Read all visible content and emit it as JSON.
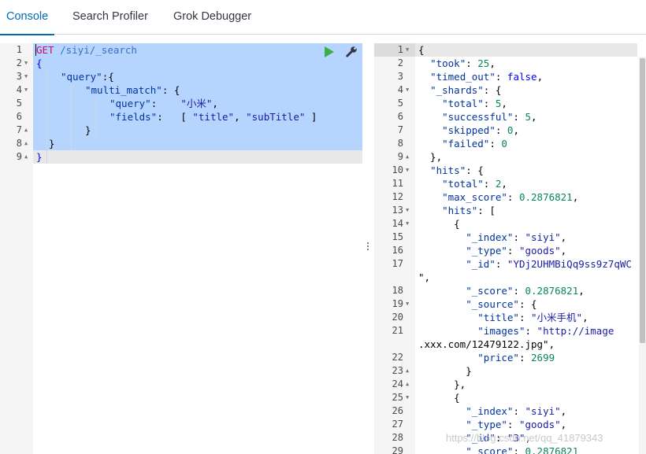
{
  "tabs": [
    {
      "label": "Console",
      "active": true
    },
    {
      "label": "Search Profiler",
      "active": false
    },
    {
      "label": "Grok Debugger",
      "active": false
    }
  ],
  "request": {
    "method": "GET",
    "path": "/siyi/_search",
    "lines": [
      {
        "num": "1",
        "fold": ""
      },
      {
        "num": "2",
        "fold": "▼"
      },
      {
        "num": "3",
        "fold": "▼"
      },
      {
        "num": "4",
        "fold": "▼"
      },
      {
        "num": "5",
        "fold": ""
      },
      {
        "num": "6",
        "fold": ""
      },
      {
        "num": "7",
        "fold": "▲"
      },
      {
        "num": "8",
        "fold": "▲"
      },
      {
        "num": "9",
        "fold": "▲"
      }
    ],
    "tokens": {
      "open_brace": "{",
      "query_key": "\"query\"",
      "query_sep": ":{",
      "multi_match_key": "\"multi_match\"",
      "multi_match_sep": ": {",
      "inner_query_key": "\"query\"",
      "inner_query_sep": ":    ",
      "inner_query_val": "\"小米\"",
      "inner_query_end": ",",
      "fields_key": "\"fields\"",
      "fields_sep": ":   [ ",
      "field1": "\"title\"",
      "field_comma": ", ",
      "field2": "\"subTitle\"",
      "fields_end": " ]",
      "close_inner": "}",
      "close_query": "}",
      "close_root": "}"
    }
  },
  "toolbar": {
    "run_icon": "play-icon",
    "settings_icon": "wrench-icon",
    "run_color": "#3caf48"
  },
  "response": {
    "lines": [
      {
        "num": "1",
        "fold": "▼"
      },
      {
        "num": "2",
        "fold": ""
      },
      {
        "num": "3",
        "fold": ""
      },
      {
        "num": "4",
        "fold": "▼"
      },
      {
        "num": "5",
        "fold": ""
      },
      {
        "num": "6",
        "fold": ""
      },
      {
        "num": "7",
        "fold": ""
      },
      {
        "num": "8",
        "fold": ""
      },
      {
        "num": "9",
        "fold": "▲"
      },
      {
        "num": "10",
        "fold": "▼"
      },
      {
        "num": "11",
        "fold": ""
      },
      {
        "num": "12",
        "fold": ""
      },
      {
        "num": "13",
        "fold": "▼"
      },
      {
        "num": "14",
        "fold": "▼"
      },
      {
        "num": "15",
        "fold": ""
      },
      {
        "num": "16",
        "fold": ""
      },
      {
        "num": "17",
        "fold": ""
      },
      {
        "num": "",
        "fold": ""
      },
      {
        "num": "18",
        "fold": ""
      },
      {
        "num": "19",
        "fold": "▼"
      },
      {
        "num": "20",
        "fold": ""
      },
      {
        "num": "21",
        "fold": ""
      },
      {
        "num": "",
        "fold": ""
      },
      {
        "num": "22",
        "fold": ""
      },
      {
        "num": "23",
        "fold": "▲"
      },
      {
        "num": "24",
        "fold": "▲"
      },
      {
        "num": "25",
        "fold": "▼"
      },
      {
        "num": "26",
        "fold": ""
      },
      {
        "num": "27",
        "fold": ""
      },
      {
        "num": "28",
        "fold": ""
      },
      {
        "num": "29",
        "fold": ""
      }
    ],
    "text": [
      "{",
      "  \"took\": 25,",
      "  \"timed_out\": false,",
      "  \"_shards\": {",
      "    \"total\": 5,",
      "    \"successful\": 5,",
      "    \"skipped\": 0,",
      "    \"failed\": 0",
      "  },",
      "  \"hits\": {",
      "    \"total\": 2,",
      "    \"max_score\": 0.2876821,",
      "    \"hits\": [",
      "      {",
      "        \"_index\": \"siyi\",",
      "        \"_type\": \"goods\",",
      "        \"_id\": \"YDj2UHMBiQq9ss9z7qWC",
      "\",",
      "        \"_score\": 0.2876821,",
      "        \"_source\": {",
      "          \"title\": \"小米手机\",",
      "          \"images\": \"http://image",
      ".xxx.com/12479122.jpg\",",
      "          \"price\": 2699",
      "        }",
      "      },",
      "      {",
      "        \"_index\": \"siyi\",",
      "        \"_type\": \"goods\",",
      "        \"_id\": \"3\",",
      "        \"_score\": 0.2876821"
    ]
  },
  "watermark": "https://blog.csdn.net/qq_41879343"
}
